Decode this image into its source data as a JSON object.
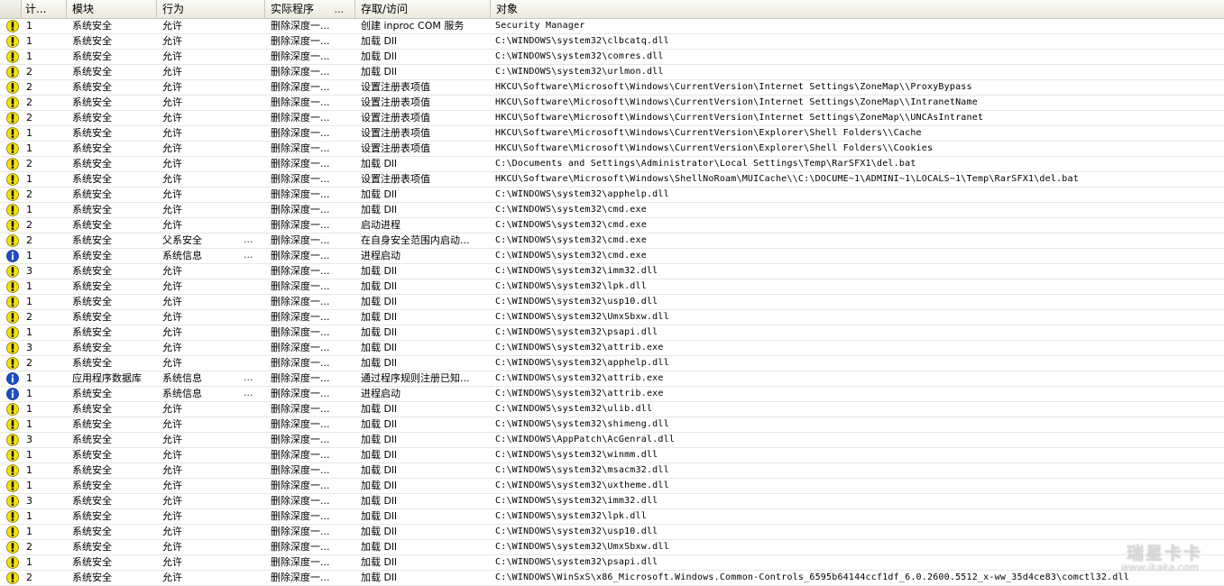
{
  "columns": {
    "count": "计...",
    "module": "模块",
    "action": "行为",
    "program": "实际程序",
    "program_dots": "...",
    "access": "存取/访问",
    "object": "对象"
  },
  "colors": {
    "warning_icon": "#f4e010",
    "info_icon": "#1b4fc9",
    "header_bg": "#ecebdf",
    "row_border": "#e7e7e7"
  },
  "icons": {
    "warning": "warning-icon",
    "info": "info-icon"
  },
  "rows": [
    {
      "icon": "warning",
      "count": "1",
      "module": "系统安全",
      "action": "允许",
      "action_dots": "",
      "program": "删除深度一...",
      "access": "创建 inproc COM 服务",
      "object": "Security Manager"
    },
    {
      "icon": "warning",
      "count": "1",
      "module": "系统安全",
      "action": "允许",
      "action_dots": "",
      "program": "删除深度一...",
      "access": "加载 Dll",
      "object": "C:\\WINDOWS\\system32\\clbcatq.dll"
    },
    {
      "icon": "warning",
      "count": "1",
      "module": "系统安全",
      "action": "允许",
      "action_dots": "",
      "program": "删除深度一...",
      "access": "加载 Dll",
      "object": "C:\\WINDOWS\\system32\\comres.dll"
    },
    {
      "icon": "warning",
      "count": "2",
      "module": "系统安全",
      "action": "允许",
      "action_dots": "",
      "program": "删除深度一...",
      "access": "加载 Dll",
      "object": "C:\\WINDOWS\\system32\\urlmon.dll"
    },
    {
      "icon": "warning",
      "count": "2",
      "module": "系统安全",
      "action": "允许",
      "action_dots": "",
      "program": "删除深度一...",
      "access": "设置注册表项值",
      "object": "HKCU\\Software\\Microsoft\\Windows\\CurrentVersion\\Internet Settings\\ZoneMap\\\\ProxyBypass"
    },
    {
      "icon": "warning",
      "count": "2",
      "module": "系统安全",
      "action": "允许",
      "action_dots": "",
      "program": "删除深度一...",
      "access": "设置注册表项值",
      "object": "HKCU\\Software\\Microsoft\\Windows\\CurrentVersion\\Internet Settings\\ZoneMap\\\\IntranetName"
    },
    {
      "icon": "warning",
      "count": "2",
      "module": "系统安全",
      "action": "允许",
      "action_dots": "",
      "program": "删除深度一...",
      "access": "设置注册表项值",
      "object": "HKCU\\Software\\Microsoft\\Windows\\CurrentVersion\\Internet Settings\\ZoneMap\\\\UNCAsIntranet"
    },
    {
      "icon": "warning",
      "count": "1",
      "module": "系统安全",
      "action": "允许",
      "action_dots": "",
      "program": "删除深度一...",
      "access": "设置注册表项值",
      "object": "HKCU\\Software\\Microsoft\\Windows\\CurrentVersion\\Explorer\\Shell Folders\\\\Cache"
    },
    {
      "icon": "warning",
      "count": "1",
      "module": "系统安全",
      "action": "允许",
      "action_dots": "",
      "program": "删除深度一...",
      "access": "设置注册表项值",
      "object": "HKCU\\Software\\Microsoft\\Windows\\CurrentVersion\\Explorer\\Shell Folders\\\\Cookies"
    },
    {
      "icon": "warning",
      "count": "2",
      "module": "系统安全",
      "action": "允许",
      "action_dots": "",
      "program": "删除深度一...",
      "access": "加载 Dll",
      "object": "C:\\Documents and Settings\\Administrator\\Local Settings\\Temp\\RarSFX1\\del.bat"
    },
    {
      "icon": "warning",
      "count": "1",
      "module": "系统安全",
      "action": "允许",
      "action_dots": "",
      "program": "删除深度一...",
      "access": "设置注册表项值",
      "object": "HKCU\\Software\\Microsoft\\Windows\\ShellNoRoam\\MUICache\\\\C:\\DOCUME~1\\ADMINI~1\\LOCALS~1\\Temp\\RarSFX1\\del.bat"
    },
    {
      "icon": "warning",
      "count": "2",
      "module": "系统安全",
      "action": "允许",
      "action_dots": "",
      "program": "删除深度一...",
      "access": "加载 Dll",
      "object": "C:\\WINDOWS\\system32\\apphelp.dll"
    },
    {
      "icon": "warning",
      "count": "1",
      "module": "系统安全",
      "action": "允许",
      "action_dots": "",
      "program": "删除深度一...",
      "access": "加载 Dll",
      "object": "C:\\WINDOWS\\system32\\cmd.exe"
    },
    {
      "icon": "warning",
      "count": "2",
      "module": "系统安全",
      "action": "允许",
      "action_dots": "",
      "program": "删除深度一...",
      "access": "启动进程",
      "object": "C:\\WINDOWS\\system32\\cmd.exe"
    },
    {
      "icon": "warning",
      "count": "2",
      "module": "系统安全",
      "action": "父系安全",
      "action_dots": "...",
      "program": "删除深度一...",
      "access": "在自身安全范围内启动...",
      "object": "C:\\WINDOWS\\system32\\cmd.exe"
    },
    {
      "icon": "info",
      "count": "1",
      "module": "系统安全",
      "action": "系统信息",
      "action_dots": "...",
      "program": "删除深度一...",
      "access": "进程启动",
      "object": "C:\\WINDOWS\\system32\\cmd.exe"
    },
    {
      "icon": "warning",
      "count": "3",
      "module": "系统安全",
      "action": "允许",
      "action_dots": "",
      "program": "删除深度一...",
      "access": "加载 Dll",
      "object": "C:\\WINDOWS\\system32\\imm32.dll"
    },
    {
      "icon": "warning",
      "count": "1",
      "module": "系统安全",
      "action": "允许",
      "action_dots": "",
      "program": "删除深度一...",
      "access": "加载 Dll",
      "object": "C:\\WINDOWS\\system32\\lpk.dll"
    },
    {
      "icon": "warning",
      "count": "1",
      "module": "系统安全",
      "action": "允许",
      "action_dots": "",
      "program": "删除深度一...",
      "access": "加载 Dll",
      "object": "C:\\WINDOWS\\system32\\usp10.dll"
    },
    {
      "icon": "warning",
      "count": "2",
      "module": "系统安全",
      "action": "允许",
      "action_dots": "",
      "program": "删除深度一...",
      "access": "加载 Dll",
      "object": "C:\\WINDOWS\\system32\\UmxSbxw.dll"
    },
    {
      "icon": "warning",
      "count": "1",
      "module": "系统安全",
      "action": "允许",
      "action_dots": "",
      "program": "删除深度一...",
      "access": "加载 Dll",
      "object": "C:\\WINDOWS\\system32\\psapi.dll"
    },
    {
      "icon": "warning",
      "count": "3",
      "module": "系统安全",
      "action": "允许",
      "action_dots": "",
      "program": "删除深度一...",
      "access": "加载 Dll",
      "object": "C:\\WINDOWS\\system32\\attrib.exe"
    },
    {
      "icon": "warning",
      "count": "2",
      "module": "系统安全",
      "action": "允许",
      "action_dots": "",
      "program": "删除深度一...",
      "access": "加载 Dll",
      "object": "C:\\WINDOWS\\system32\\apphelp.dll"
    },
    {
      "icon": "info",
      "count": "1",
      "module": "应用程序数据库",
      "action": "系统信息",
      "action_dots": "...",
      "program": "删除深度一...",
      "access": "通过程序规则注册已知...",
      "object": "C:\\WINDOWS\\system32\\attrib.exe"
    },
    {
      "icon": "info",
      "count": "1",
      "module": "系统安全",
      "action": "系统信息",
      "action_dots": "...",
      "program": "删除深度一...",
      "access": "进程启动",
      "object": "C:\\WINDOWS\\system32\\attrib.exe"
    },
    {
      "icon": "warning",
      "count": "1",
      "module": "系统安全",
      "action": "允许",
      "action_dots": "",
      "program": "删除深度一...",
      "access": "加载 Dll",
      "object": "C:\\WINDOWS\\system32\\ulib.dll"
    },
    {
      "icon": "warning",
      "count": "1",
      "module": "系统安全",
      "action": "允许",
      "action_dots": "",
      "program": "删除深度一...",
      "access": "加载 Dll",
      "object": "C:\\WINDOWS\\system32\\shimeng.dll"
    },
    {
      "icon": "warning",
      "count": "3",
      "module": "系统安全",
      "action": "允许",
      "action_dots": "",
      "program": "删除深度一...",
      "access": "加载 Dll",
      "object": "C:\\WINDOWS\\AppPatch\\AcGenral.dll"
    },
    {
      "icon": "warning",
      "count": "1",
      "module": "系统安全",
      "action": "允许",
      "action_dots": "",
      "program": "删除深度一...",
      "access": "加载 Dll",
      "object": "C:\\WINDOWS\\system32\\winmm.dll"
    },
    {
      "icon": "warning",
      "count": "1",
      "module": "系统安全",
      "action": "允许",
      "action_dots": "",
      "program": "删除深度一...",
      "access": "加载 Dll",
      "object": "C:\\WINDOWS\\system32\\msacm32.dll"
    },
    {
      "icon": "warning",
      "count": "1",
      "module": "系统安全",
      "action": "允许",
      "action_dots": "",
      "program": "删除深度一...",
      "access": "加载 Dll",
      "object": "C:\\WINDOWS\\system32\\uxtheme.dll"
    },
    {
      "icon": "warning",
      "count": "3",
      "module": "系统安全",
      "action": "允许",
      "action_dots": "",
      "program": "删除深度一...",
      "access": "加载 Dll",
      "object": "C:\\WINDOWS\\system32\\imm32.dll"
    },
    {
      "icon": "warning",
      "count": "1",
      "module": "系统安全",
      "action": "允许",
      "action_dots": "",
      "program": "删除深度一...",
      "access": "加载 Dll",
      "object": "C:\\WINDOWS\\system32\\lpk.dll"
    },
    {
      "icon": "warning",
      "count": "1",
      "module": "系统安全",
      "action": "允许",
      "action_dots": "",
      "program": "删除深度一...",
      "access": "加载 Dll",
      "object": "C:\\WINDOWS\\system32\\usp10.dll"
    },
    {
      "icon": "warning",
      "count": "2",
      "module": "系统安全",
      "action": "允许",
      "action_dots": "",
      "program": "删除深度一...",
      "access": "加载 Dll",
      "object": "C:\\WINDOWS\\system32\\UmxSbxw.dll"
    },
    {
      "icon": "warning",
      "count": "1",
      "module": "系统安全",
      "action": "允许",
      "action_dots": "",
      "program": "删除深度一...",
      "access": "加载 Dll",
      "object": "C:\\WINDOWS\\system32\\psapi.dll"
    },
    {
      "icon": "warning",
      "count": "2",
      "module": "系统安全",
      "action": "允许",
      "action_dots": "",
      "program": "删除深度一...",
      "access": "加载 Dll",
      "object": "C:\\WINDOWS\\WinSxS\\x86_Microsoft.Windows.Common-Controls_6595b64144ccf1df_6.0.2600.5512_x-ww_35d4ce83\\comctl32.dll"
    }
  ],
  "watermark": {
    "title": "瑞星卡卡",
    "url": "www.ikaka.com"
  }
}
